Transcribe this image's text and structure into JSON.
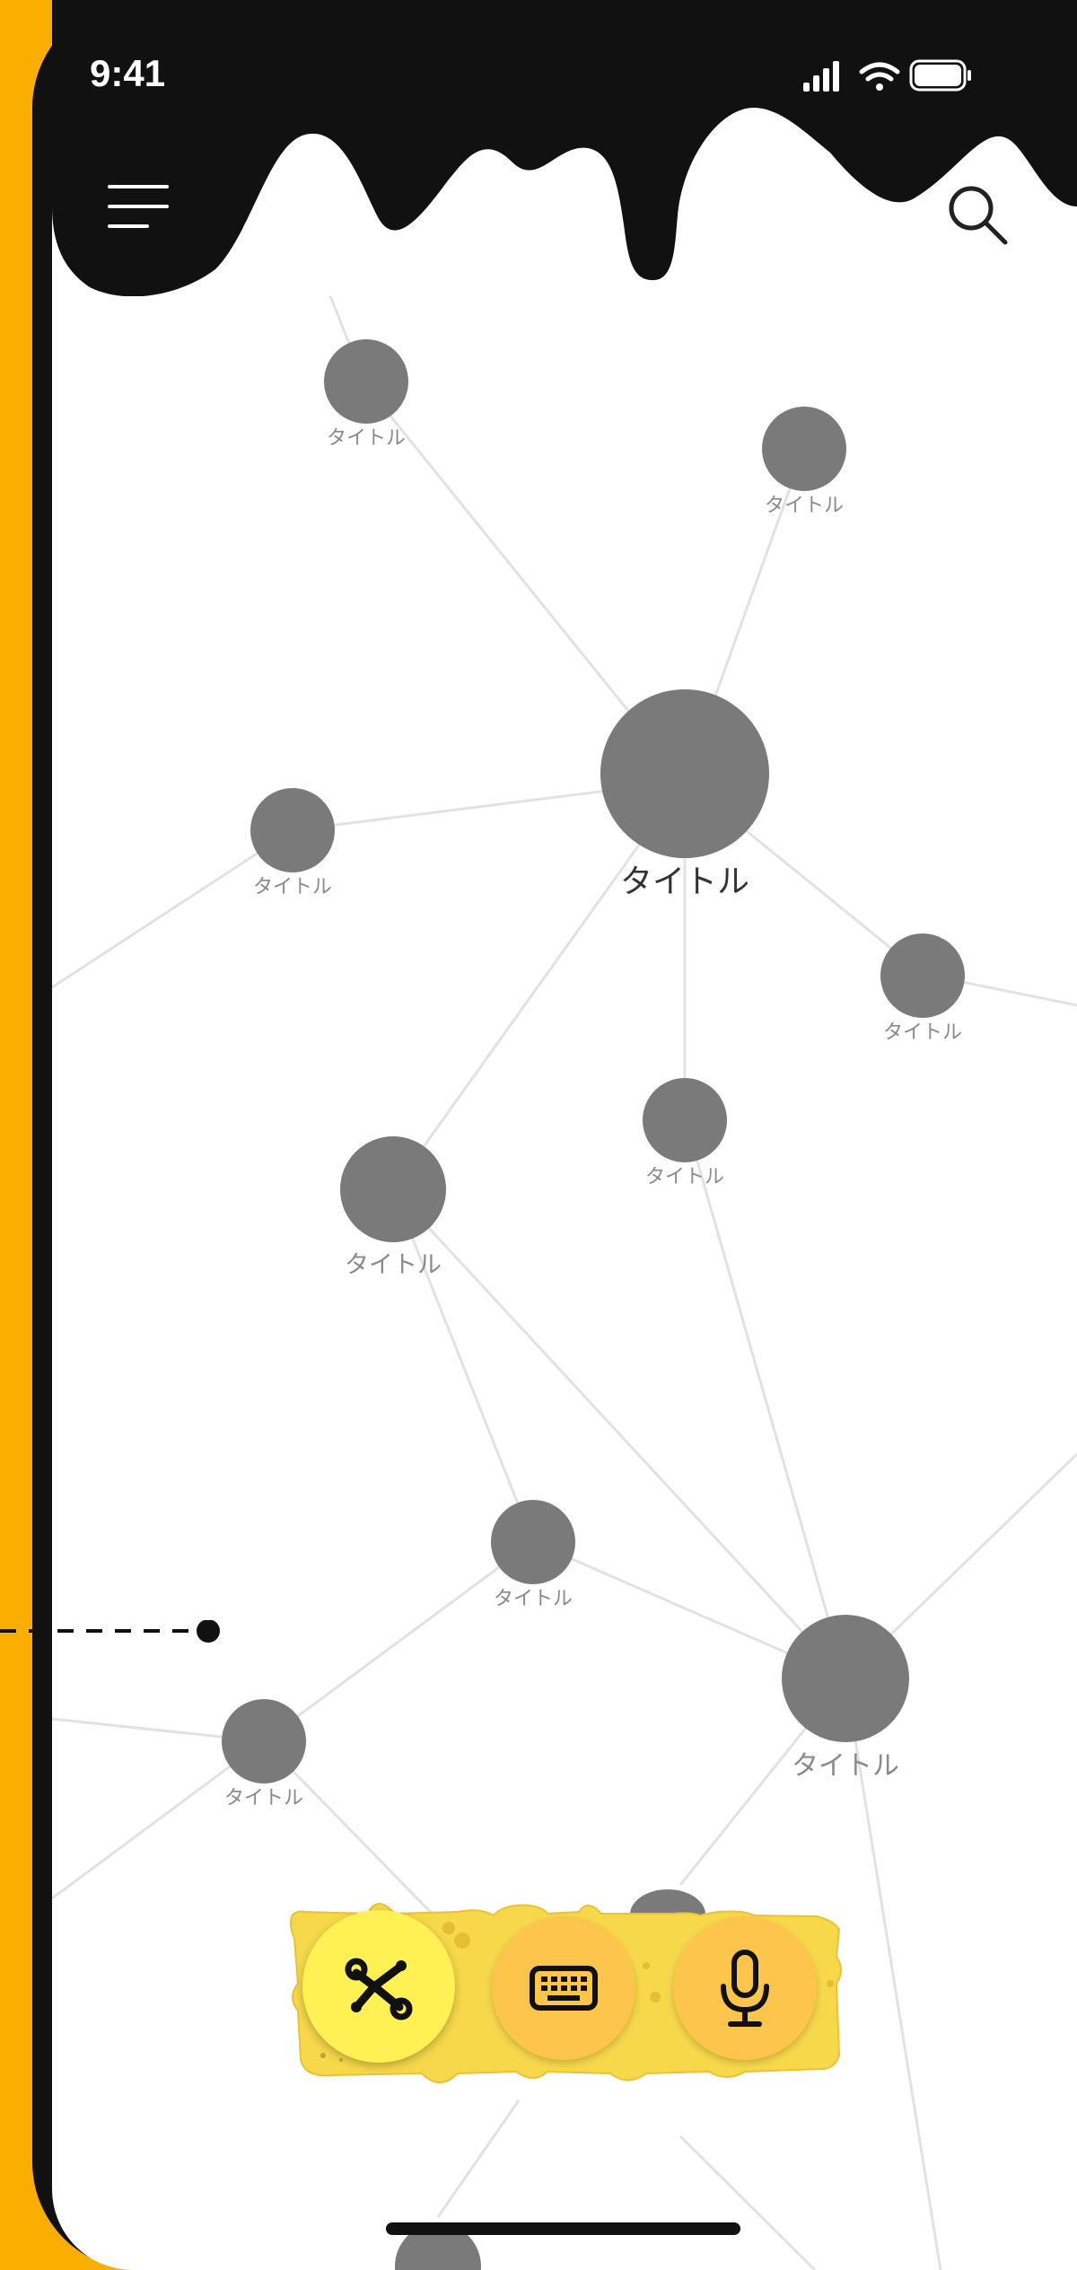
{
  "status_bar": {
    "time": "9:41",
    "icons": [
      "signal-icon",
      "wifi-icon",
      "battery-icon"
    ]
  },
  "header": {
    "menu_icon": "hamburger-menu-icon",
    "search_icon": "search-icon",
    "style": "black drip"
  },
  "graph": {
    "nodes": [
      {
        "id": "n1",
        "label": "タイトル"
      },
      {
        "id": "n2",
        "label": "タイトル"
      },
      {
        "id": "n-center",
        "label": "タイトル"
      },
      {
        "id": "n3",
        "label": "タイトル"
      },
      {
        "id": "n4",
        "label": "タイトル"
      },
      {
        "id": "n5",
        "label": "タイトル"
      },
      {
        "id": "n6",
        "label": "タイトル"
      },
      {
        "id": "n7",
        "label": "タイトル"
      },
      {
        "id": "n8",
        "label": "タイトル"
      },
      {
        "id": "n9",
        "label": "タイトル"
      }
    ]
  },
  "toolbar": {
    "buttons": [
      {
        "name": "graph-view-button",
        "icon": "graph-icon",
        "active": true
      },
      {
        "name": "keyboard-button",
        "icon": "keyboard-icon",
        "active": false
      },
      {
        "name": "microphone-button",
        "icon": "microphone-icon",
        "active": false
      }
    ]
  },
  "colors": {
    "background": "#F9AE00",
    "node": "#7A7A7A",
    "edge": "#E0E0E0",
    "toolbar": "#F7D84A",
    "active_button": "#FFF053",
    "button": "#FDC54C"
  }
}
